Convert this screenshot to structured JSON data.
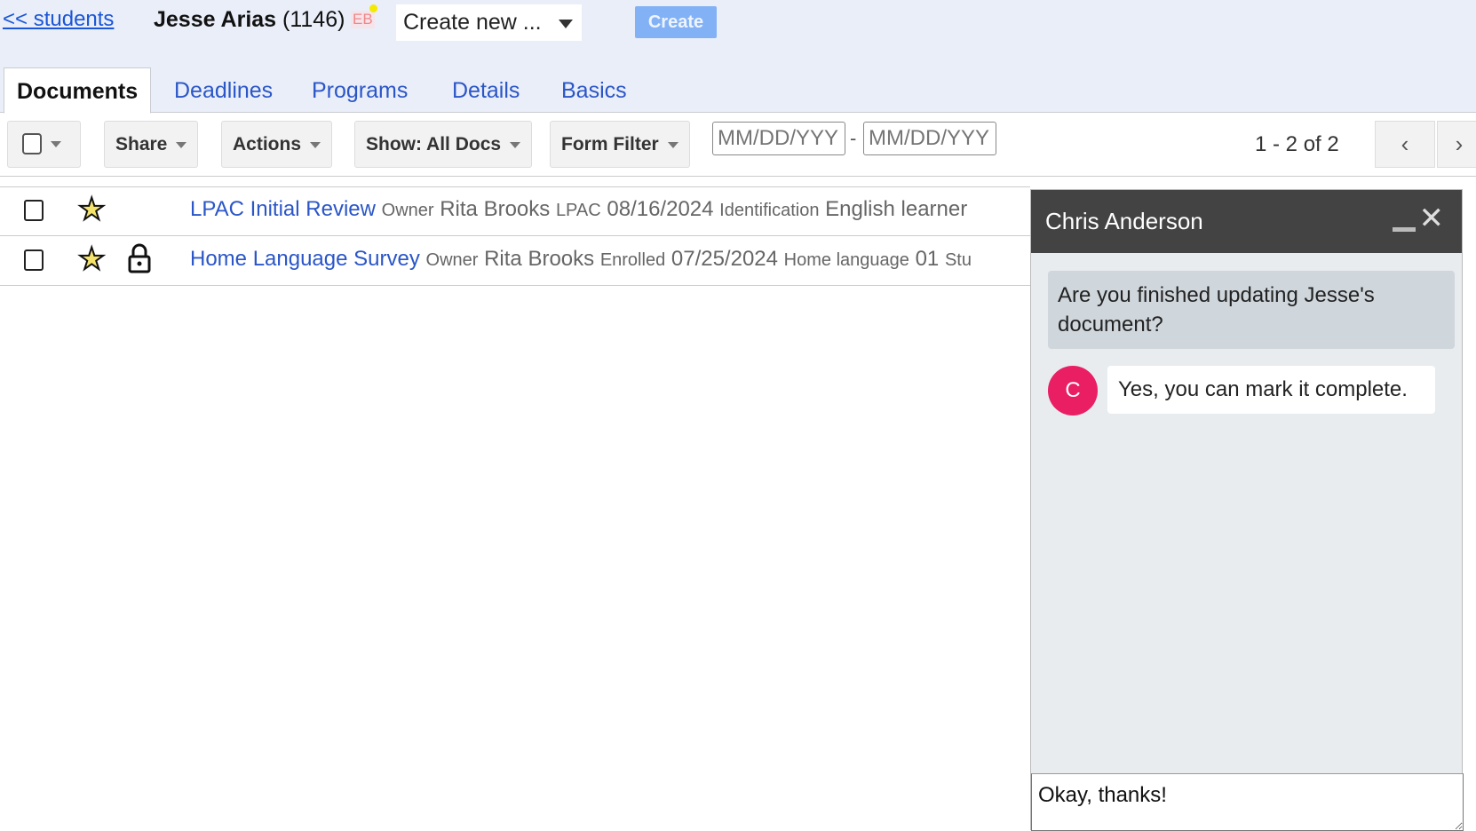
{
  "header": {
    "back_link": "<< students",
    "student_name": "Jesse Arias",
    "student_id": "(1146)",
    "badge": "EB",
    "create_select": "Create new ...",
    "create_button": "Create"
  },
  "tabs": [
    {
      "label": "Documents",
      "active": true
    },
    {
      "label": "Deadlines"
    },
    {
      "label": "Programs"
    },
    {
      "label": "Details"
    },
    {
      "label": "Basics"
    }
  ],
  "toolbar": {
    "share": "Share",
    "actions": "Actions",
    "show": "Show: All Docs",
    "form_filter": "Form Filter",
    "date_from_placeholder": "MM/DD/YYY",
    "date_to_placeholder": "MM/DD/YYY",
    "date_sep": "-",
    "pagination": "1 - 2 of 2"
  },
  "documents": [
    {
      "title": "LPAC Initial Review",
      "owner_label": "Owner",
      "owner": "Rita Brooks",
      "f1_label": "LPAC",
      "f1": "08/16/2024",
      "f2_label": "Identification",
      "f2": "English learner",
      "starred": true,
      "locked": false
    },
    {
      "title": "Home Language Survey",
      "owner_label": "Owner",
      "owner": "Rita Brooks",
      "f1_label": "Enrolled",
      "f1": "07/25/2024",
      "f2_label": "Home language",
      "f2": "01",
      "f3_label": "Stu",
      "starred": true,
      "locked": true
    }
  ],
  "chat": {
    "contact": "Chris Anderson",
    "messages": [
      {
        "from": "me",
        "text": "Are you finished updating Jesse's document?"
      },
      {
        "from": "Chris Anderson",
        "avatar": "C",
        "text": "Yes, you can mark it complete."
      }
    ],
    "input_value": "Okay, thanks!"
  },
  "colors": {
    "link": "#2b56c8",
    "header_bg": "#e9eef8",
    "create_button": "#82b2f5",
    "chat_header": "#434343",
    "avatar": "#e91e63"
  }
}
